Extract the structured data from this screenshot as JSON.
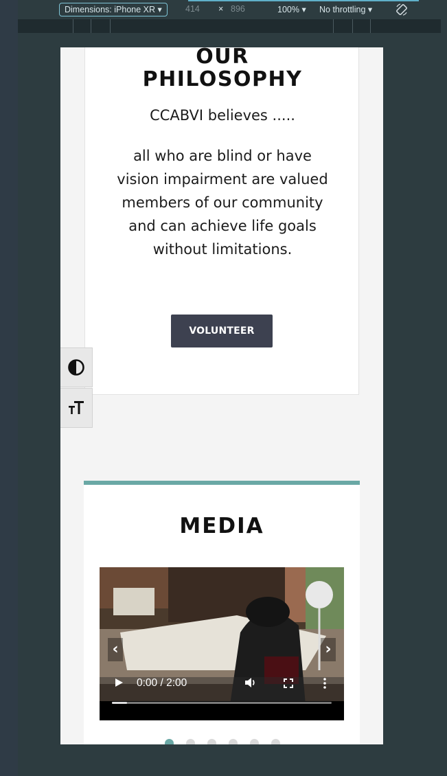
{
  "devtools": {
    "device_label": "Dimensions: iPhone XR ▾",
    "width": "414",
    "times": "×",
    "height": "896",
    "zoom": "100% ▾",
    "throttling": "No throttling ▾"
  },
  "philosophy": {
    "title": "OUR PHILOSOPHY",
    "believes": "CCABVI believes .....",
    "text": "all who are blind or have vision impairment are valued members of our community and can achieve life goals without limitations.",
    "button_label": "VOLUNTEER"
  },
  "media": {
    "title": "MEDIA",
    "time": "0:00 / 2:00",
    "progress": 0.07,
    "slide_count": 6,
    "active_slide": 0
  },
  "colors": {
    "accent": "#6aa8a5",
    "button": "#3d4150",
    "devtools_highlight": "#7fc6d8"
  }
}
